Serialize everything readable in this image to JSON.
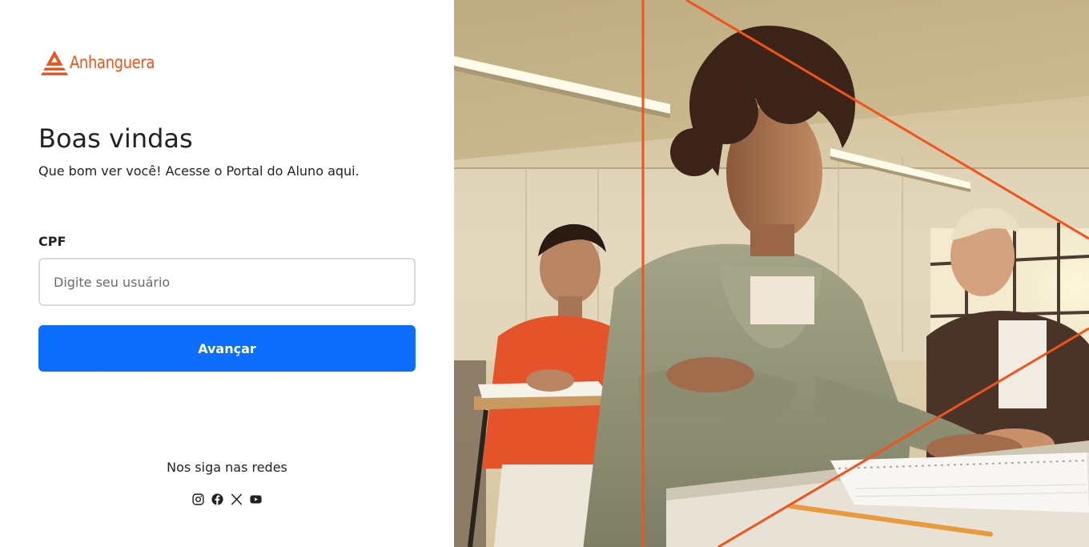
{
  "brand": {
    "name": "Anhanguera",
    "color": "#f0531c"
  },
  "login": {
    "title": "Boas vindas",
    "subtitle": "Que bom ver você! Acesse o Portal do Aluno aqui.",
    "cpf_label": "CPF",
    "cpf_placeholder": "Digite seu usuário",
    "cpf_value": "",
    "submit_label": "Avançar",
    "submit_color": "#0d6efd"
  },
  "social": {
    "title": "Nos siga nas redes",
    "icons": [
      "instagram-icon",
      "facebook-icon",
      "x-icon",
      "youtube-icon"
    ]
  },
  "hero": {
    "description_icon": "students-classroom-photo",
    "accent_line_color": "#f0531c"
  }
}
